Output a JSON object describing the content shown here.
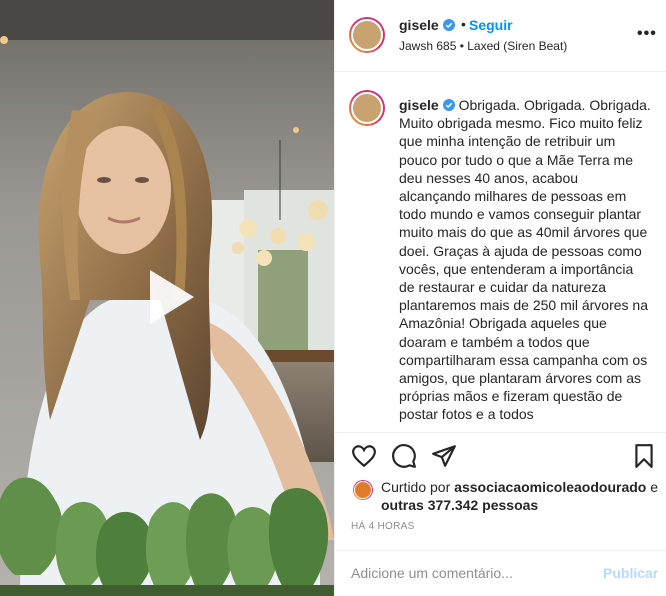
{
  "post": {
    "username": "gisele",
    "follow_label": "Seguir",
    "separator": "•",
    "audio": "Jawsh 685 • Laxed (Siren Beat)",
    "more_label": "•••",
    "caption_text": "Obrigada. Obrigada. Obrigada. Muito obrigada mesmo. Fico muito feliz que minha intenção de retribuir um pouco por tudo o que a Mãe Terra me deu nesses 40 anos, acabou alcançando milhares de pessoas em todo mundo e vamos conseguir plantar muito mais do que as 40mil árvores que doei. Graças à ajuda de pessoas como vocês, que entenderam a importância de restaurar e cuidar da natureza plantaremos mais de 250 mil árvores na Amazônia! Obrigada aqueles que doaram e também a todos que compartilharam essa campanha com os amigos, que plantaram árvores com as próprias mãos e fizeram questão de postar fotos e a todos"
  },
  "likes": {
    "prefix": "Curtido por ",
    "first_user": "associacaomicoleaodourado",
    "middle": " e",
    "others_prefix": "outras ",
    "others_count": "377.342",
    "others_suffix": " pessoas"
  },
  "timestamp": "HÁ 4 HORAS",
  "comment": {
    "placeholder": "Adicione um comentário...",
    "publish_label": "Publicar"
  },
  "icons": {
    "verified": "verified-badge-icon",
    "like": "heart-icon",
    "comment": "comment-bubble-icon",
    "share": "paper-plane-icon",
    "save": "bookmark-icon",
    "play": "play-icon"
  },
  "colors": {
    "link_blue": "#0095f6",
    "publish_disabled": "#b3dbff",
    "muted": "#8e8e8e",
    "text": "#262626"
  }
}
